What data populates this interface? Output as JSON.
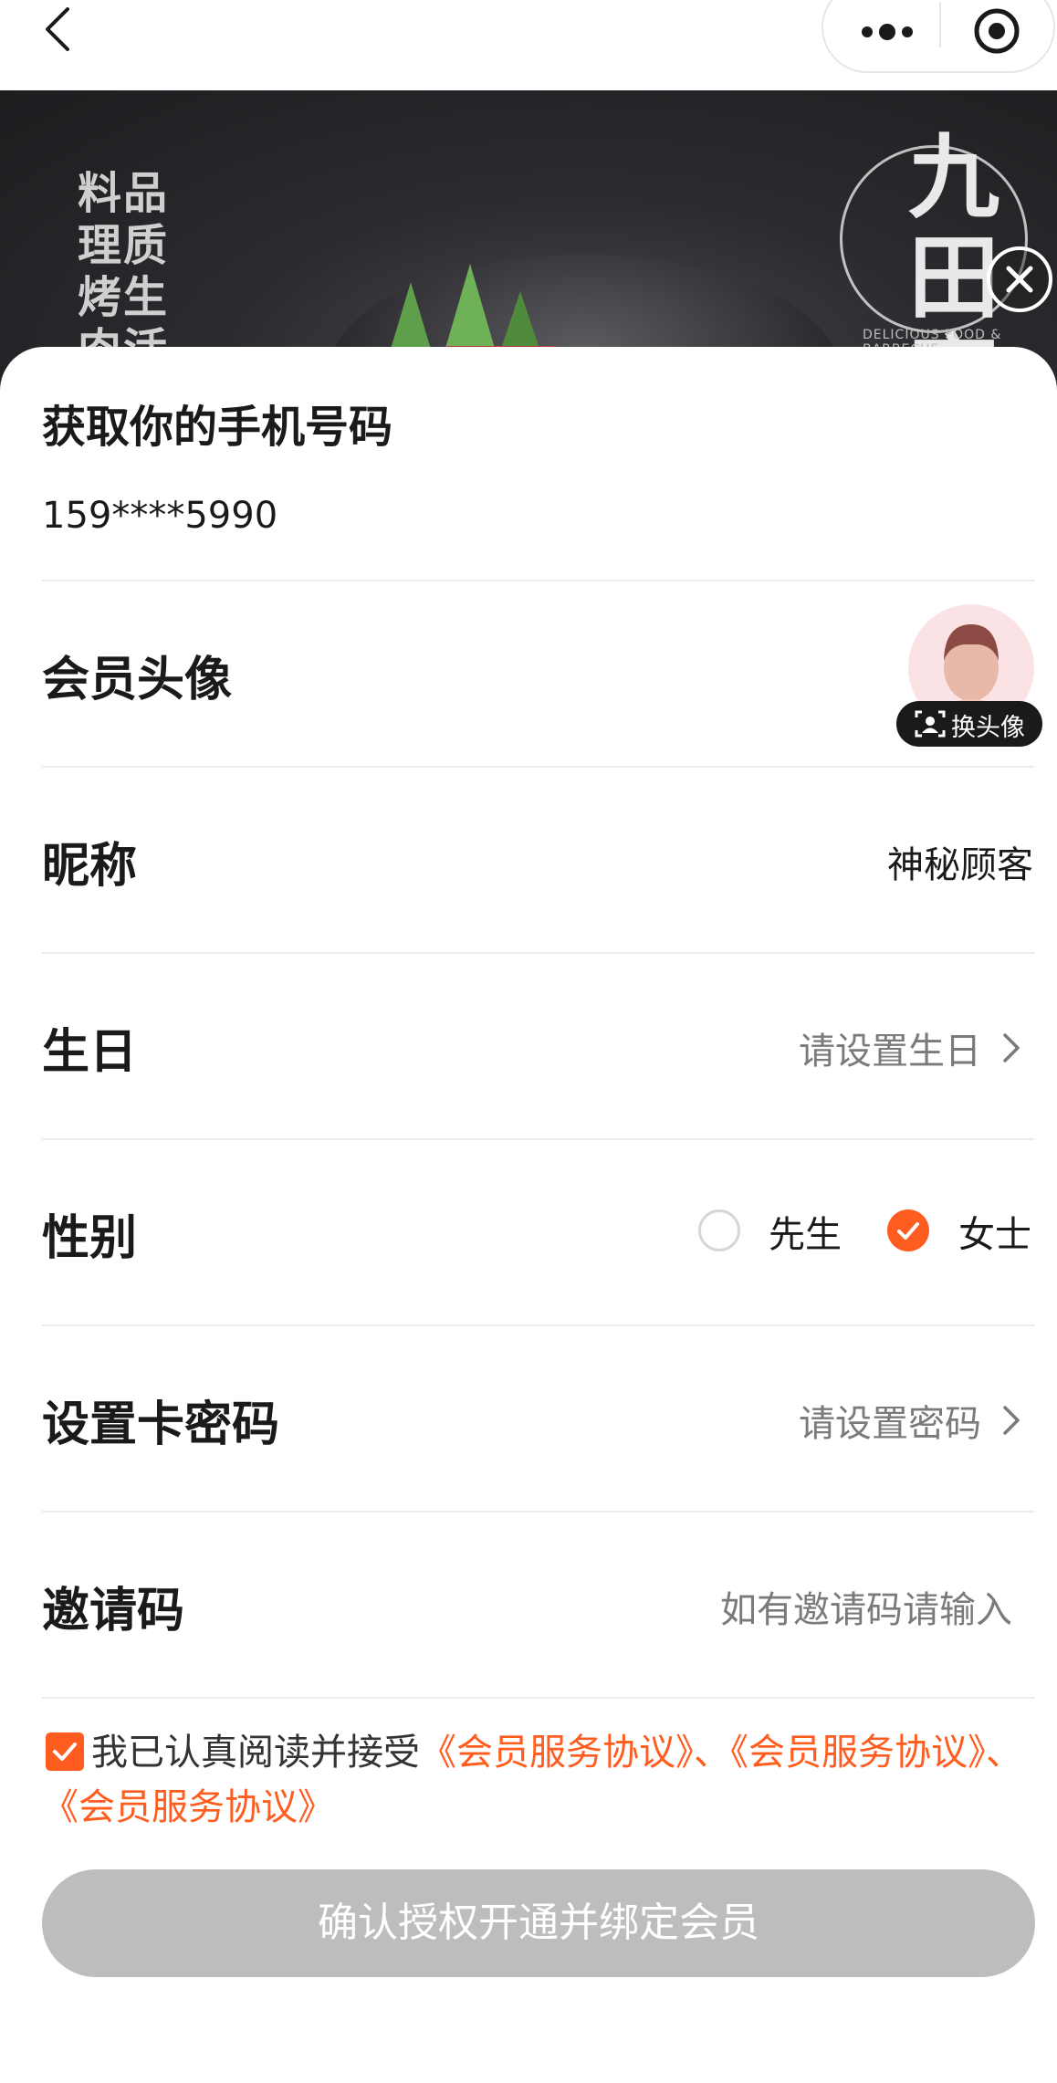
{
  "nav": {
    "back_icon": "chevron-left-icon",
    "more_icon": "more-dots-icon",
    "target_icon": "record-target-icon"
  },
  "banner": {
    "side_text": "料品\n理质\n烤生\n肉活",
    "logo_text": "九田家",
    "logo_subtext": "DELICIOUS FOOD & BARBECUE"
  },
  "sheet": {
    "title": "获取你的手机号码",
    "phone": "159****5990",
    "rows": {
      "avatar": {
        "label": "会员头像",
        "badge": "换头像"
      },
      "nickname": {
        "label": "昵称",
        "value": "神秘顾客"
      },
      "birthday": {
        "label": "生日",
        "hint": "请设置生日"
      },
      "gender": {
        "label": "性别",
        "option_male": "先生",
        "option_female": "女士",
        "selected": "女士"
      },
      "password": {
        "label": "设置卡密码",
        "hint": "请设置密码"
      },
      "invite": {
        "label": "邀请码",
        "placeholder": "如有邀请码请输入"
      }
    },
    "agreement": {
      "checked": true,
      "prefix": "我已认真阅读并接受",
      "link1": "《会员服务协议》",
      "sep1": "、",
      "link2": "《会员服务协议》",
      "sep2": "、",
      "link3": "《会员服务协议》"
    },
    "confirm_label": "确认授权开通并绑定会员"
  },
  "colors": {
    "accent": "#ff5d1f",
    "disabled_button": "#bdbdbd",
    "divider": "#ececec"
  }
}
